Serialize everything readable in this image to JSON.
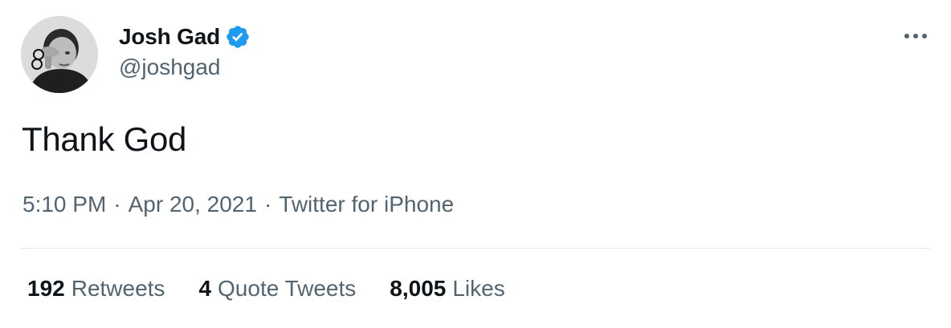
{
  "author": {
    "display_name": "Josh Gad",
    "handle": "@joshgad",
    "verified_icon": "verified-badge-icon",
    "avatar_icon": "profile-photo"
  },
  "tweet": {
    "text": "Thank God",
    "time": "5:10 PM",
    "date": "Apr 20, 2021",
    "source": "Twitter for iPhone",
    "separator": "·"
  },
  "stats": {
    "retweets_count": "192",
    "retweets_label": "Retweets",
    "quotes_count": "4",
    "quotes_label": "Quote Tweets",
    "likes_count": "8,005",
    "likes_label": "Likes"
  },
  "colors": {
    "text_primary": "#0f1419",
    "text_secondary": "#536471",
    "verified_blue": "#1d9bf0",
    "divider": "#e1e8ed"
  },
  "menu_icon": "more-horizontal-icon"
}
